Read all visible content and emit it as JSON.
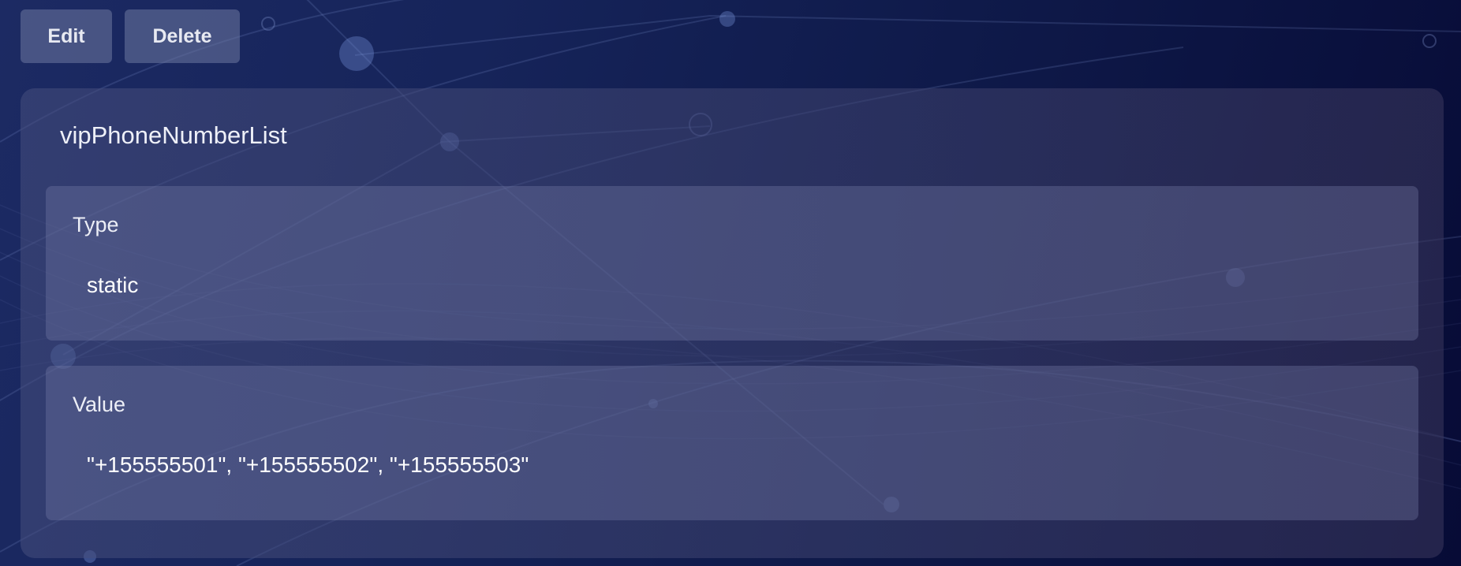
{
  "toolbar": {
    "edit_label": "Edit",
    "delete_label": "Delete"
  },
  "variable": {
    "name": "vipPhoneNumberList",
    "fields": {
      "type": {
        "label": "Type",
        "value": "static"
      },
      "value": {
        "label": "Value",
        "value": "\"+155555501\", \"+155555502\", \"+155555503\""
      }
    }
  },
  "colors": {
    "background_start": "#1c2a63",
    "background_end": "#070b36",
    "button_bg": "#5a6288",
    "text": "#ffffff"
  }
}
